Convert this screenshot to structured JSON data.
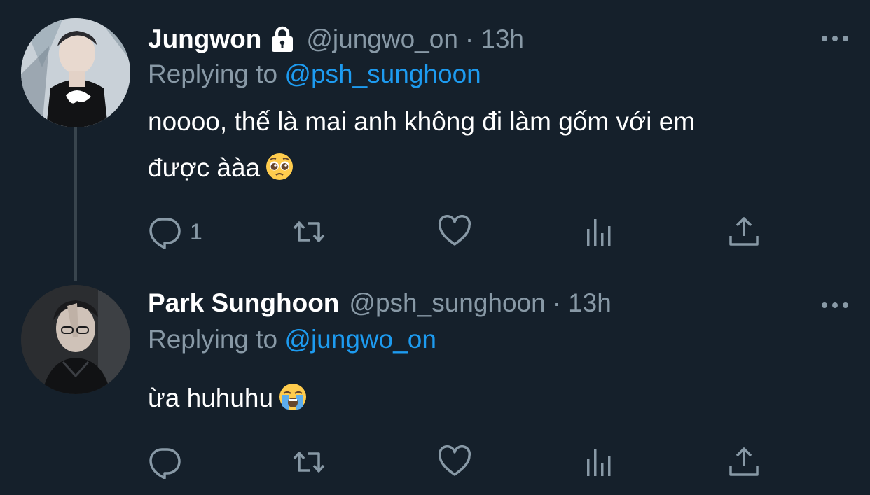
{
  "tweets": [
    {
      "display_name": "Jungwon",
      "locked": true,
      "handle": "@jungwo_on",
      "separator": "·",
      "time": "13h",
      "replying_prefix": "Replying to",
      "replying_to": "@psh_sunghoon",
      "text_line_1": "noooo, thế là mai anh không đi làm gốm với em",
      "text_line_2": "được ààa",
      "emoji": "pleading-face",
      "reply_count": "1"
    },
    {
      "display_name": "Park Sunghoon",
      "locked": false,
      "handle": "@psh_sunghoon",
      "separator": "·",
      "time": "13h",
      "replying_prefix": "Replying to",
      "replying_to": "@jungwo_on",
      "text_line_1": "ừa huhuhu",
      "emoji": "loudly-crying-face",
      "reply_count": ""
    }
  ],
  "colors": {
    "background": "#15202b",
    "primary_text": "#ffffff",
    "secondary_text": "#8899a6",
    "accent": "#1d9bf0",
    "thread_line": "#38444d"
  },
  "icons": [
    "lock-icon",
    "more-icon",
    "reply-icon",
    "retweet-icon",
    "like-icon",
    "analytics-icon",
    "share-icon"
  ]
}
